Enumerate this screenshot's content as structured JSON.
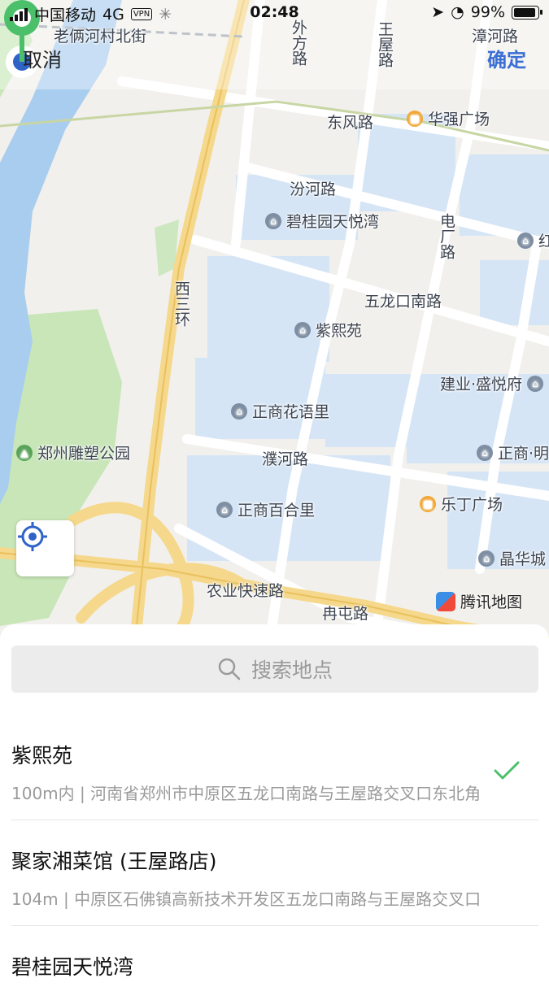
{
  "status_bar": {
    "carrier": "中国移动",
    "network": "4G",
    "vpn": "VPN",
    "time": "02:48",
    "battery_text": "99%",
    "battery_level": 0.99
  },
  "header": {
    "cancel": "取消",
    "confirm": "确定"
  },
  "map": {
    "roads": {
      "laoliang": "老俩河村北街",
      "waifang": "外方路",
      "wangwu": "王屋路",
      "zhanghe": "漳河路",
      "dongfeng": "东风路",
      "fenhe": "汾河路",
      "dianchang": "电厂路",
      "wulongkou": "五龙口南路",
      "xisanhuan": "西三环",
      "puhe": "濮河路",
      "nongye": "农业快速路",
      "rantun": "冉屯路"
    },
    "pois": {
      "huaqiang": "华强广场",
      "biguiyuan": "碧桂园天悦湾",
      "hong": "红",
      "zixiyuan": "紫熙苑",
      "jianye": "建业·盛悦府",
      "zhengshang_huayu": "正商花语里",
      "sculpture_park": "郑州雕塑公园",
      "zhengshang_ming": "正商·明",
      "leding": "乐丁广场",
      "zhengshang_baihe": "正商百合里",
      "jinghua": "晶华城"
    },
    "brand": "腾讯地图"
  },
  "search": {
    "placeholder": "搜索地点"
  },
  "results": [
    {
      "name": "紫熙苑",
      "address": "100m内 | 河南省郑州市中原区五龙口南路与王屋路交叉口东北角",
      "selected": true
    },
    {
      "name": "聚家湘菜馆 (王屋路店)",
      "address": "104m | 中原区石佛镇高新技术开发区五龙口南路与王屋路交叉口",
      "selected": false
    },
    {
      "name": "碧桂园天悦湾",
      "address": "",
      "selected": false
    }
  ],
  "colors": {
    "accent_blue": "#3b6fd4",
    "pin_green": "#4cbf6a",
    "check_green": "#4cbf6a"
  }
}
